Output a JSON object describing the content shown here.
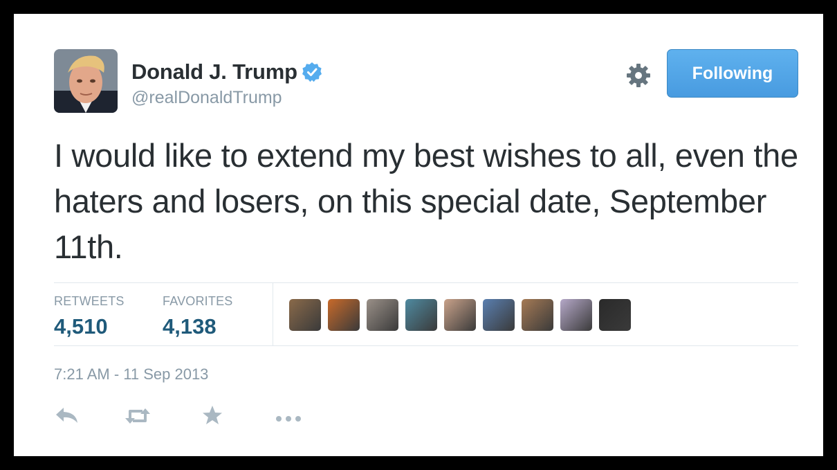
{
  "user": {
    "name": "Donald J. Trump",
    "handle": "@realDonaldTrump",
    "verified": true
  },
  "follow_button": {
    "label": "Following"
  },
  "settings_icon": "gear-icon",
  "tweet": {
    "text": "I would like to extend my best wishes to all, even the haters and losers, on this special date, September 11th."
  },
  "stats": {
    "retweets": {
      "label": "RETWEETS",
      "value": "4,510"
    },
    "favorites": {
      "label": "FAVORITES",
      "value": "4,138"
    }
  },
  "favoriters": [
    {
      "name": "favoriter-avatar-1",
      "color": "#8a6a4a"
    },
    {
      "name": "favoriter-avatar-2",
      "color": "#c86a2a"
    },
    {
      "name": "favoriter-avatar-3",
      "color": "#9a9088"
    },
    {
      "name": "favoriter-avatar-4",
      "color": "#4f8aa0"
    },
    {
      "name": "favoriter-avatar-5",
      "color": "#c9a28a"
    },
    {
      "name": "favoriter-avatar-6",
      "color": "#5a7fb0"
    },
    {
      "name": "favoriter-avatar-7",
      "color": "#a57a55"
    },
    {
      "name": "favoriter-avatar-8",
      "color": "#b5a8c8"
    },
    {
      "name": "favoriter-avatar-9",
      "color": "#2a2a2a"
    }
  ],
  "timestamp": "7:21 AM - 11 Sep 2013",
  "actions": [
    "reply-icon",
    "retweet-icon",
    "favorite-icon",
    "more-icon"
  ],
  "colors": {
    "accent": "#55acee",
    "text": "#292f33",
    "muted": "#8899a6",
    "stat_value": "#1f5a7a"
  }
}
